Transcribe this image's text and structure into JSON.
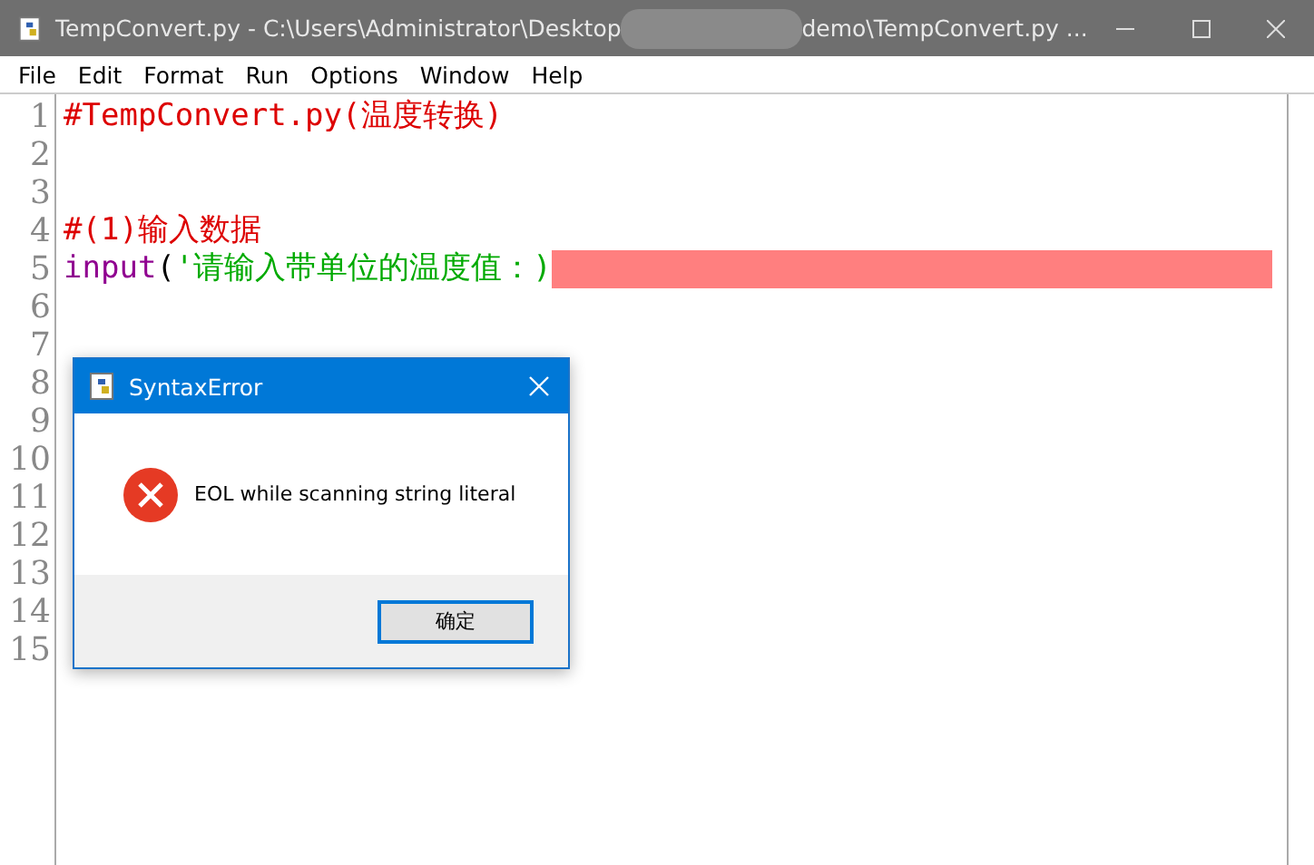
{
  "window": {
    "title_start": "TempConvert.py - C:\\Users\\Administrator\\Desktop",
    "title_end": "demo\\TempConvert.py ..."
  },
  "menu": [
    "File",
    "Edit",
    "Format",
    "Run",
    "Options",
    "Window",
    "Help"
  ],
  "editor": {
    "lines": [
      {
        "number": "1",
        "error": false,
        "segments": [
          {
            "kind": "comment",
            "text": "#TempConvert.py(温度转换)"
          }
        ]
      },
      {
        "number": "2",
        "error": false
      },
      {
        "number": "3",
        "error": false
      },
      {
        "number": "4",
        "error": false,
        "segments": [
          {
            "kind": "comment",
            "text": "#(1)输入数据"
          }
        ]
      },
      {
        "number": "5",
        "error": true,
        "segments": [
          {
            "kind": "builtin",
            "text": "input"
          },
          {
            "kind": "plain",
            "text": "("
          },
          {
            "kind": "string",
            "text": "'请输入带单位的温度值：)"
          }
        ]
      },
      {
        "number": "6",
        "error": false
      },
      {
        "number": "7",
        "error": false
      },
      {
        "number": "8",
        "error": false
      },
      {
        "number": "9",
        "error": false
      },
      {
        "number": "10",
        "error": false
      },
      {
        "number": "11",
        "error": false
      },
      {
        "number": "12",
        "error": false
      },
      {
        "number": "13",
        "error": false
      },
      {
        "number": "14",
        "error": false
      },
      {
        "number": "15",
        "error": false
      }
    ]
  },
  "dialog": {
    "title": "SyntaxError",
    "message": "EOL while scanning string literal",
    "button": "确定"
  }
}
